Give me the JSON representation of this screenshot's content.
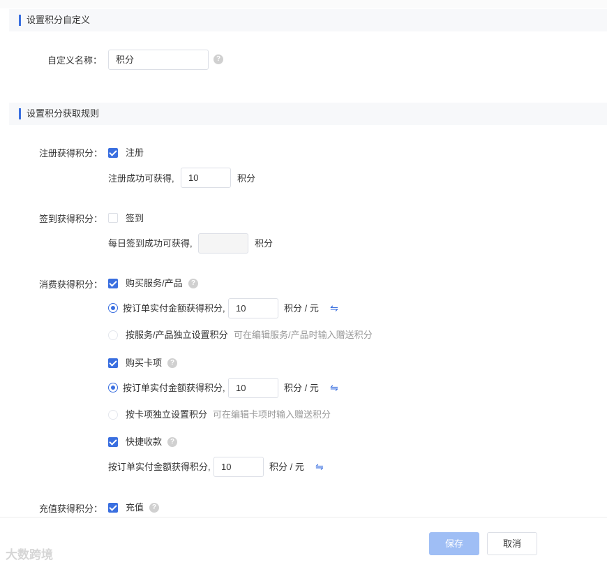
{
  "sections": {
    "custom": {
      "title": "设置积分自定义"
    },
    "rules": {
      "title": "设置积分获取规则"
    }
  },
  "custom_name": {
    "label": "自定义名称：",
    "value": "积分"
  },
  "register": {
    "label": "注册获得积分：",
    "checkbox_label": "注册",
    "checked": true,
    "prefix": "注册成功可获得,",
    "value": "10",
    "unit": "积分"
  },
  "signin": {
    "label": "签到获得积分：",
    "checkbox_label": "签到",
    "checked": false,
    "prefix": "每日签到成功可获得,",
    "value": "",
    "unit": "积分"
  },
  "consume": {
    "label": "消费获得积分：",
    "purchase_service": {
      "checkbox_label": "购买服务/产品",
      "checked": true,
      "option_amount": {
        "label": "按订单实付金额获得积分,",
        "value": "10",
        "unit": "积分 / 元",
        "selected": true
      },
      "option_independent": {
        "label": "按服务/产品独立设置积分",
        "hint": "可在编辑服务/产品时输入赠送积分",
        "selected": false
      }
    },
    "purchase_card": {
      "checkbox_label": "购买卡项",
      "checked": true,
      "option_amount": {
        "label": "按订单实付金额获得积分,",
        "value": "10",
        "unit": "积分 / 元",
        "selected": true
      },
      "option_independent": {
        "label": "按卡项独立设置积分",
        "hint": "可在编辑卡项时输入赠送积分",
        "selected": false
      }
    },
    "quick_pay": {
      "checkbox_label": "快捷收款",
      "checked": true,
      "amount_label": "按订单实付金额获得积分,",
      "value": "10",
      "unit": "积分 / 元"
    }
  },
  "recharge": {
    "label": "充值获得积分：",
    "checkbox_label": "充值",
    "checked": true
  },
  "footer": {
    "save_label": "保存",
    "cancel_label": "取消"
  },
  "watermark": "大数跨境",
  "icons": {
    "help": "question-circle-icon",
    "swap": "swap-arrows-icon",
    "check": "check-icon"
  },
  "colors": {
    "accent": "#3a6fe0",
    "save_button": "#9fbef5",
    "section_bg": "#f7f8fa"
  }
}
